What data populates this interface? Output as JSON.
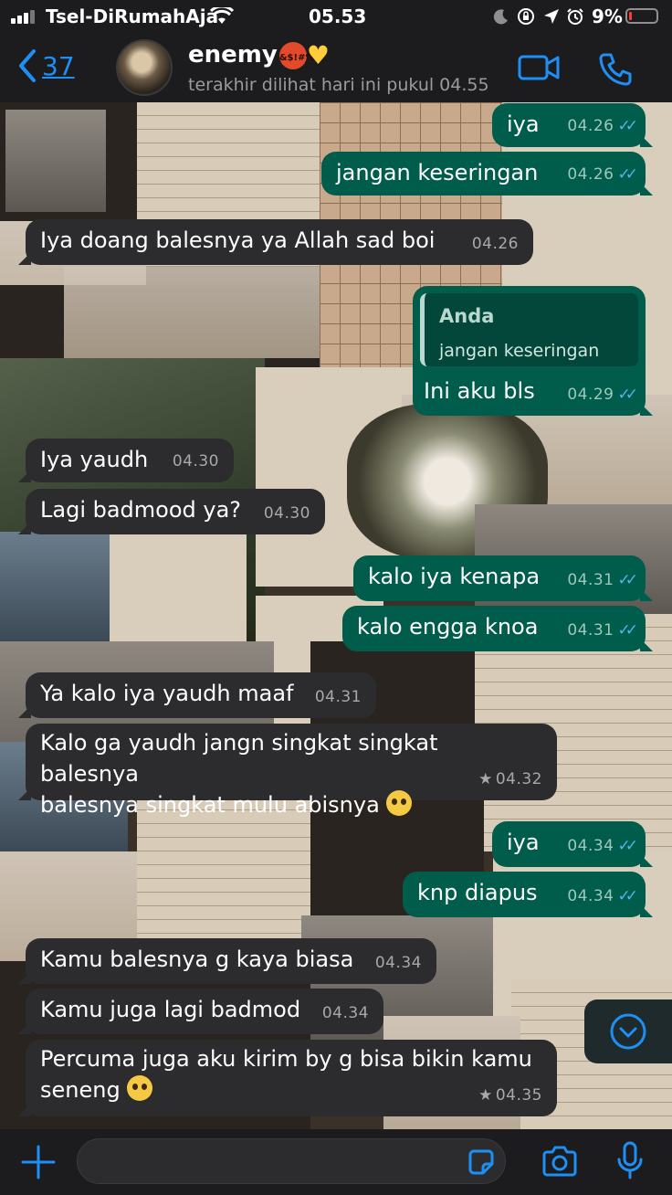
{
  "status_bar": {
    "carrier": "Tsel-DiRumahAja",
    "time": "05.53",
    "battery_percent": "9%"
  },
  "header": {
    "back_count": "37",
    "contact_name": "enemy",
    "angry_emoji_text": "&$!#%",
    "last_seen": "terakhir dilihat hari ini pukul 04.55"
  },
  "messages": [
    {
      "dir": "out",
      "text": "iya",
      "time": "04.26",
      "read": true
    },
    {
      "dir": "out",
      "text": "jangan keseringan",
      "time": "04.26",
      "read": true
    },
    {
      "dir": "in",
      "text": "Iya doang balesnya ya Allah sad boi",
      "time": "04.26"
    },
    {
      "dir": "out",
      "reply_author": "Anda",
      "reply_text": "jangan keseringan",
      "text": "Ini aku bls",
      "time": "04.29",
      "read": true
    },
    {
      "dir": "in",
      "text": "Iya yaudh",
      "time": "04.30"
    },
    {
      "dir": "in",
      "text": "Lagi badmood ya?",
      "time": "04.30"
    },
    {
      "dir": "out",
      "text": "kalo iya kenapa",
      "time": "04.31",
      "read": true
    },
    {
      "dir": "out",
      "text": "kalo engga knoa",
      "time": "04.31",
      "read": true
    },
    {
      "dir": "in",
      "text": "Ya kalo iya yaudh maaf",
      "time": "04.31"
    },
    {
      "dir": "in",
      "line1": "Kalo ga yaudh jangn singkat singkat balesnya",
      "line2": "balesnya singkat mulu abisnya",
      "time": "04.32",
      "starred": true
    },
    {
      "dir": "out",
      "text": "iya",
      "time": "04.34",
      "read": true
    },
    {
      "dir": "out",
      "text": "knp diapus",
      "time": "04.34",
      "read": true
    },
    {
      "dir": "in",
      "text": "Kamu balesnya g kaya biasa",
      "time": "04.34"
    },
    {
      "dir": "in",
      "text": "Kamu juga lagi badmod",
      "time": "04.34"
    },
    {
      "dir": "in",
      "line1": "Percuma juga aku kirim by g bisa bikin kamu",
      "line2": "seneng",
      "time": "04.35",
      "starred": true
    }
  ],
  "colors": {
    "accent": "#1e8ff5",
    "outgoing_bubble": "#005c4b",
    "incoming_bubble": "#2c2c2e",
    "read_ticks": "#4fb6ec"
  },
  "icons": {
    "back": "chevron-left-icon",
    "video": "video-camera-icon",
    "phone": "phone-icon",
    "scroll_down": "chevron-down-circle-icon",
    "attach": "plus-icon",
    "sticker": "sticker-icon",
    "camera": "camera-icon",
    "mic": "microphone-icon"
  },
  "ui": {
    "ticks": "✓✓",
    "star": "★"
  }
}
